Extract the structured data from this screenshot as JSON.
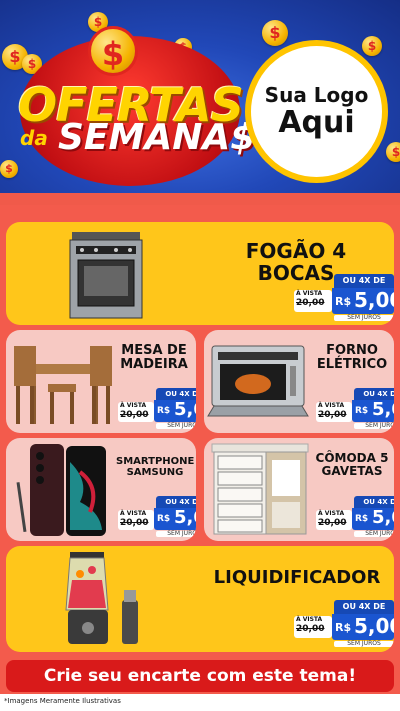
{
  "header": {
    "title_line1": "OFERTAS",
    "title_da": "da",
    "title_line2": "SEMANA$",
    "dollar_symbol": "$",
    "logo_line1": "Sua Logo",
    "logo_line2": "Aqui"
  },
  "price_labels": {
    "installments": "OU 4X DE",
    "cash": "À VISTA",
    "old_price": "20,00",
    "currency": "R$",
    "price": "5,00",
    "no_interest": "SEM JUROS"
  },
  "products": [
    {
      "name": "FOGÃO 4 BOCAS",
      "icon": "stove-icon"
    },
    {
      "name": "MESA DE MADEIRA",
      "icon": "table-chairs-icon"
    },
    {
      "name": "FORNO ELÉTRICO",
      "icon": "oven-icon"
    },
    {
      "name": "SMARTPHONE SAMSUNG",
      "icon": "smartphone-icon"
    },
    {
      "name": "CÔMODA 5 GAVETAS",
      "icon": "dresser-icon"
    },
    {
      "name": "LIQUIDIFICADOR",
      "icon": "blender-icon"
    }
  ],
  "cta": "Crie seu encarte com este tema!",
  "disclaimer": "*Imagens Meramente Ilustrativas",
  "colors": {
    "blue": "#2148b8",
    "red": "#f35b4c",
    "yellow": "#ffc61a",
    "pink": "#f7c9c3",
    "price_blue": "#1a55d0"
  }
}
